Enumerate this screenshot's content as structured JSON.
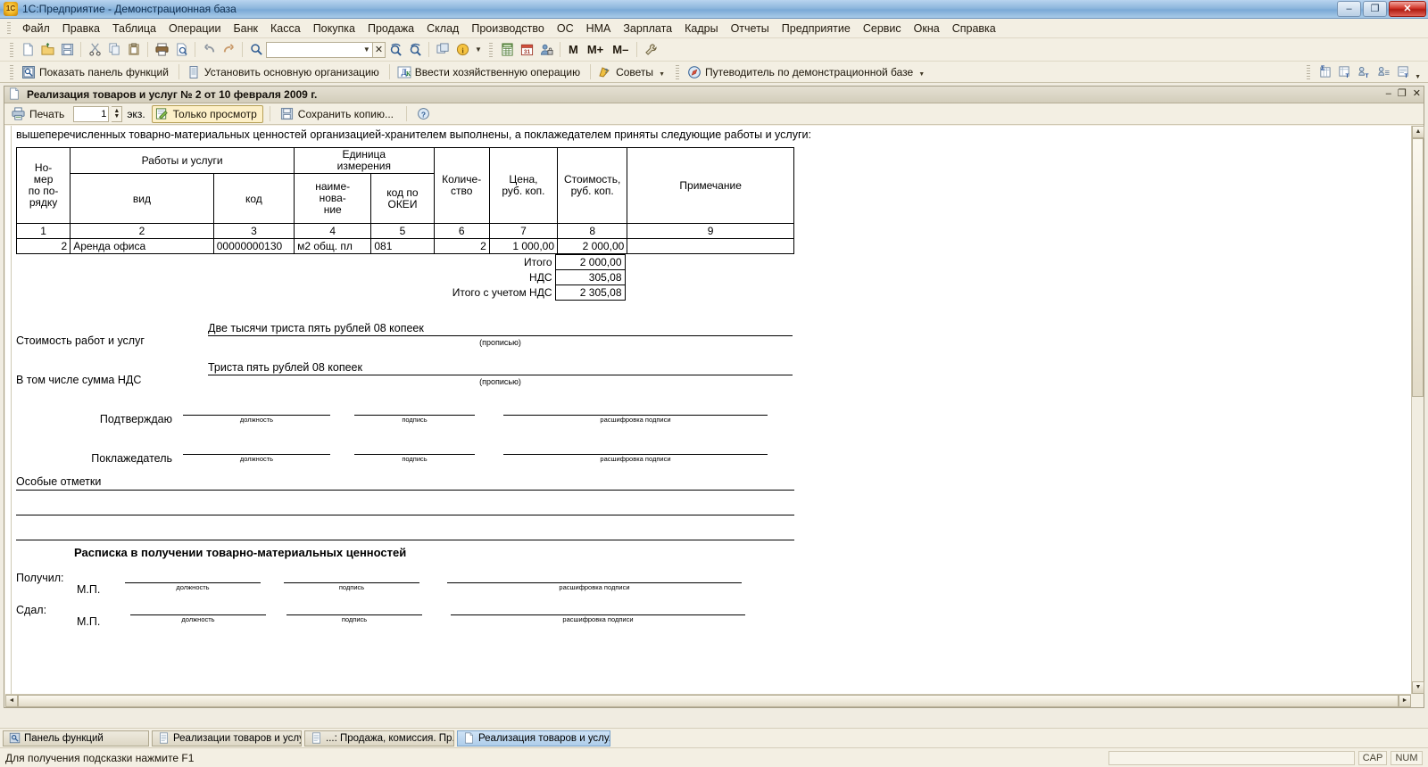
{
  "window": {
    "title": "1C:Предприятие - Демонстрационная база",
    "app_icon": "1c-logo-icon",
    "minimize": "–",
    "restore": "❐",
    "close": "✕"
  },
  "menubar": {
    "items": [
      {
        "label": "Файл",
        "accel": "Ф"
      },
      {
        "label": "Правка",
        "accel": "П"
      },
      {
        "label": "Таблица",
        "accel": "Т"
      },
      {
        "label": "Операции",
        "accel": "О"
      },
      {
        "label": "Банк",
        "accel": "Б"
      },
      {
        "label": "Касса",
        "accel": "К"
      },
      {
        "label": "Покупка",
        "accel": "П"
      },
      {
        "label": "Продажа",
        "accel": "р"
      },
      {
        "label": "Склад",
        "accel": "С"
      },
      {
        "label": "Производство",
        "accel": "П"
      },
      {
        "label": "ОС",
        "accel": "О"
      },
      {
        "label": "НМА",
        "accel": "Н"
      },
      {
        "label": "Зарплата",
        "accel": "З"
      },
      {
        "label": "Кадры",
        "accel": "К"
      },
      {
        "label": "Отчеты",
        "accel": "О"
      },
      {
        "label": "Предприятие",
        "accel": "П"
      },
      {
        "label": "Сервис",
        "accel": "С"
      },
      {
        "label": "Окна",
        "accel": "О"
      },
      {
        "label": "Справка",
        "accel": "р"
      }
    ]
  },
  "toolbar_main": {
    "buttons": [
      {
        "name": "new-document-icon",
        "glyph": "📄"
      },
      {
        "name": "open-folder-icon",
        "glyph": "📂"
      },
      {
        "name": "save-icon",
        "glyph": "💾"
      },
      {
        "name": "cut-icon",
        "glyph": "✂"
      },
      {
        "name": "copy-icon",
        "glyph": "⧉"
      },
      {
        "name": "paste-icon",
        "glyph": "📋"
      },
      {
        "name": "print-icon",
        "glyph": "🖶"
      },
      {
        "name": "print-preview-icon",
        "glyph": "🔍"
      },
      {
        "name": "undo-icon",
        "glyph": "↩"
      },
      {
        "name": "redo-icon",
        "glyph": "↪"
      }
    ],
    "search": {
      "icon": "search-icon",
      "value": "",
      "placeholder": "",
      "dropdown_icon": "chevron-down-icon",
      "clear_label": "✕"
    },
    "find_buttons": [
      {
        "name": "find-next-icon",
        "glyph": "🔎"
      },
      {
        "name": "find-prev-icon",
        "glyph": "🔎"
      }
    ],
    "extra": [
      {
        "name": "windows-list-icon",
        "glyph": "❐"
      },
      {
        "name": "about-info-icon",
        "glyph": "i"
      },
      {
        "name": "calculator-icon",
        "glyph": "▦"
      },
      {
        "name": "calendar-icon",
        "glyph": "31"
      },
      {
        "name": "user-lock-icon",
        "glyph": "👤"
      }
    ],
    "memory_buttons": [
      "M",
      "M+",
      "M–"
    ],
    "tools_icon": "wrench-icon"
  },
  "toolbar_functions": {
    "buttons": [
      {
        "label": "Показать панель функций",
        "icon": "function-panel-icon"
      },
      {
        "label": "Установить основную организацию",
        "icon": "organization-icon"
      },
      {
        "label": "Ввести хозяйственную операцию",
        "icon": "business-operation-icon"
      },
      {
        "label": "Советы",
        "icon": "tips-icon",
        "has_dropdown": true
      },
      {
        "label": "Путеводитель по демонстрационной базе",
        "icon": "compass-icon",
        "has_dropdown": true
      }
    ],
    "right_icons": [
      {
        "name": "sum-report-icon",
        "glyph": "Σ"
      },
      {
        "name": "table-text-icon",
        "glyph": "▤"
      },
      {
        "name": "group-text-icon",
        "glyph": "▥"
      },
      {
        "name": "group-list-icon",
        "glyph": "▤"
      },
      {
        "name": "report-text-icon",
        "glyph": "▤"
      }
    ]
  },
  "document_window": {
    "title": "Реализация товаров и услуг № 2 от 10 февраля 2009 г.",
    "icon": "document-icon",
    "minimize": "–",
    "restore": "❐",
    "close": "✕",
    "toolbar": {
      "print_label": "Печать",
      "print_icon": "print-icon",
      "copies_value": "1",
      "copies_unit": "экз.",
      "view_only_label": "Только просмотр",
      "view_only_icon": "view-only-icon",
      "view_only_pressed": true,
      "save_copy_label": "Сохранить копию...",
      "save_copy_icon": "save-copy-icon",
      "help_label": "?",
      "help_icon": "help-icon"
    }
  },
  "sheet": {
    "intro_text": "вышеперечисленных товарно-материальных ценностей организацией-хранителем выполнены, а поклажедателем приняты следующие работы и услуги:",
    "table": {
      "header_groups": {
        "number": "Но-\nмер\nпо по-\nрядку",
        "works": "Работы и услуги",
        "unit": "Единица\nизмерения",
        "quantity": "Количе-\nство",
        "price": "Цена,\nруб. коп.",
        "cost": "Стоимость,\nруб. коп.",
        "note": "Примечание"
      },
      "subheaders": {
        "kind": "вид",
        "code": "код",
        "unit_name": "наиме-\nнова-\nние",
        "okei_code": "код по\nОКЕИ"
      },
      "column_numbers": [
        "1",
        "2",
        "3",
        "4",
        "5",
        "6",
        "7",
        "8",
        "9"
      ],
      "rows": [
        {
          "num": "2",
          "kind": "Аренда офиса",
          "code": "00000000130",
          "unit_name": "м2 общ. пл",
          "okei": "081",
          "qty": "2",
          "price": "1 000,00",
          "cost": "2 000,00",
          "note": ""
        }
      ],
      "totals": [
        {
          "label": "Итого",
          "value": "2 000,00",
          "bold": true
        },
        {
          "label": "НДС",
          "value": "305,08",
          "bold": true
        },
        {
          "label": "Итого с учетом НДС",
          "value": "2 305,08",
          "bold": true
        }
      ]
    },
    "amount_lines": [
      {
        "label": "Стоимость работ и услуг",
        "value": "Две тысячи триста пять рублей 08 копеек",
        "caption": "(прописью)"
      },
      {
        "label": "В том числе сумма НДС",
        "value": "Триста пять рублей 08 копеек",
        "caption": "(прописью)"
      }
    ],
    "signature_blocks": [
      {
        "label": "Подтверждаю",
        "fields": [
          "должность",
          "подпись",
          "расшифровка подписи"
        ]
      },
      {
        "label": "Поклажедатель",
        "fields": [
          "должность",
          "подпись",
          "расшифровка подписи"
        ]
      }
    ],
    "special_marks_label": "Особые отметки",
    "receipt_title": "Расписка в получении товарно-материальных ценностей",
    "receipt_rows": [
      {
        "label": "Получил:",
        "stamp": "М.П.",
        "fields": [
          "должность",
          "подпись",
          "расшифровка подписи"
        ]
      },
      {
        "label": "Сдал:",
        "stamp": "М.П.",
        "fields": [
          "должность",
          "подпись",
          "расшифровка подписи"
        ]
      }
    ]
  },
  "taskbar": {
    "items": [
      {
        "label": "Панель функций",
        "icon": "function-panel-icon",
        "active": false
      },
      {
        "label": "Реализации товаров и услуг",
        "icon": "list-icon",
        "active": false
      },
      {
        "label": "...: Продажа, комиссия. Пр...",
        "icon": "list-icon",
        "active": false
      },
      {
        "label": "Реализация товаров и услу...",
        "icon": "document-icon",
        "active": true
      }
    ]
  },
  "statusbar": {
    "message": "Для получения подсказки нажмите F1",
    "indicators": [
      "CAP",
      "NUM"
    ]
  },
  "colors": {
    "title_bar": "#8fb7dd",
    "chrome": "#f3efe3",
    "accent": "#b59f56",
    "active_task": "#aecdea",
    "sheet_bg": "#ffffff"
  }
}
